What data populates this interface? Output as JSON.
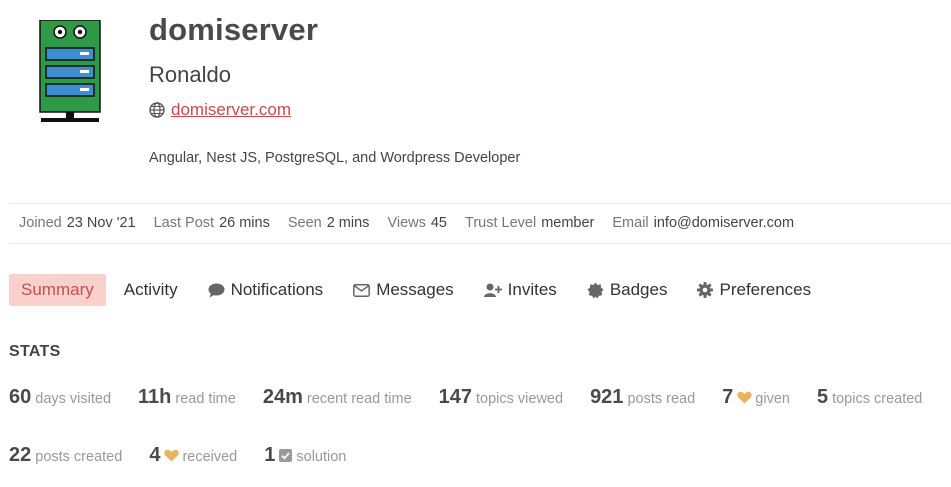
{
  "user": {
    "username": "domiserver",
    "full_name": "Ronaldo",
    "website": "domiserver.com",
    "bio": "Angular, Nest JS, PostgreSQL, and Wordpress Developer"
  },
  "meta": [
    {
      "label": "Joined",
      "value": "23 Nov '21"
    },
    {
      "label": "Last Post",
      "value": "26 mins"
    },
    {
      "label": "Seen",
      "value": "2 mins"
    },
    {
      "label": "Views",
      "value": "45"
    },
    {
      "label": "Trust Level",
      "value": "member"
    },
    {
      "label": "Email",
      "value": "info@domiserver.com"
    }
  ],
  "nav": [
    {
      "label": "Summary",
      "icon": "",
      "active": true
    },
    {
      "label": "Activity",
      "icon": ""
    },
    {
      "label": "Notifications",
      "icon": "comment-icon"
    },
    {
      "label": "Messages",
      "icon": "envelope-icon"
    },
    {
      "label": "Invites",
      "icon": "user-plus-icon"
    },
    {
      "label": "Badges",
      "icon": "badge-icon"
    },
    {
      "label": "Preferences",
      "icon": "gear-icon"
    }
  ],
  "stats": {
    "title": "STATS",
    "items": [
      {
        "value": "60",
        "label": "days visited"
      },
      {
        "value": "11h",
        "label": "read time"
      },
      {
        "value": "24m",
        "label": "recent read time"
      },
      {
        "value": "147",
        "label": "topics viewed"
      },
      {
        "value": "921",
        "label": "posts read"
      },
      {
        "value": "7",
        "label": "given",
        "icon": "heart-icon"
      },
      {
        "value": "5",
        "label": "topics created"
      },
      {
        "value": "22",
        "label": "posts created"
      },
      {
        "value": "4",
        "label": "received",
        "icon": "heart-icon"
      },
      {
        "value": "1",
        "label": "solution",
        "icon": "check-square-icon"
      }
    ]
  },
  "colors": {
    "accent": "#c84a4a",
    "active_tab_bg": "#f9d0cc",
    "heart": "#e9b462",
    "avatar_green": "#2e9a48",
    "avatar_blue": "#3e8fd0"
  }
}
